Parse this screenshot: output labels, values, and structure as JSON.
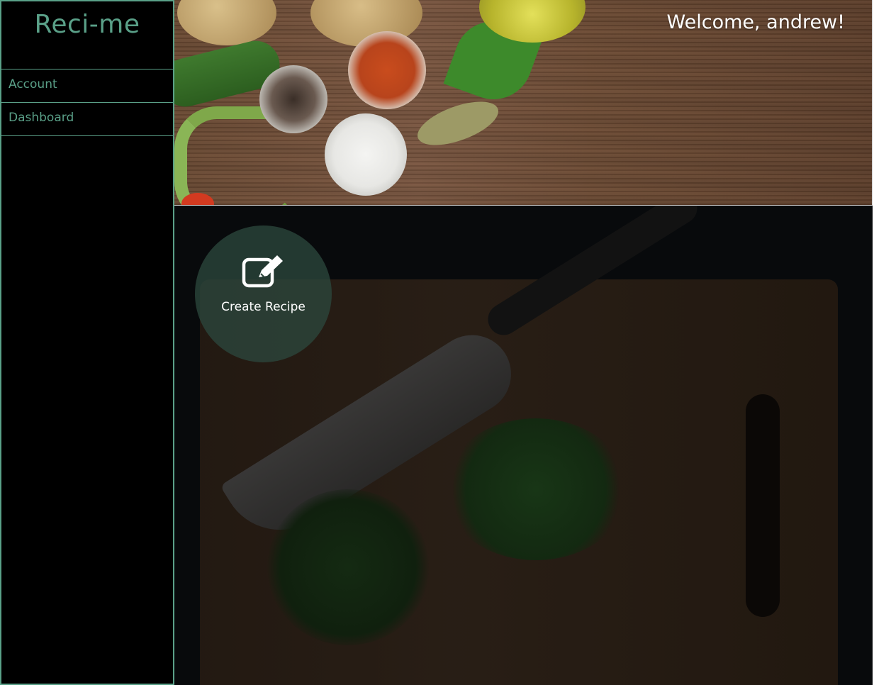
{
  "sidebar": {
    "brand": "Reci-me",
    "items": [
      {
        "label": "Account"
      },
      {
        "label": "Dashboard"
      }
    ]
  },
  "header": {
    "welcome": "Welcome, andrew!"
  },
  "main": {
    "create_recipe_label": "Create Recipe",
    "create_recipe_icon": "edit-icon"
  },
  "colors": {
    "accent": "#5aa088",
    "sidebar_bg": "#000000",
    "button_bg": "#2b463c"
  }
}
